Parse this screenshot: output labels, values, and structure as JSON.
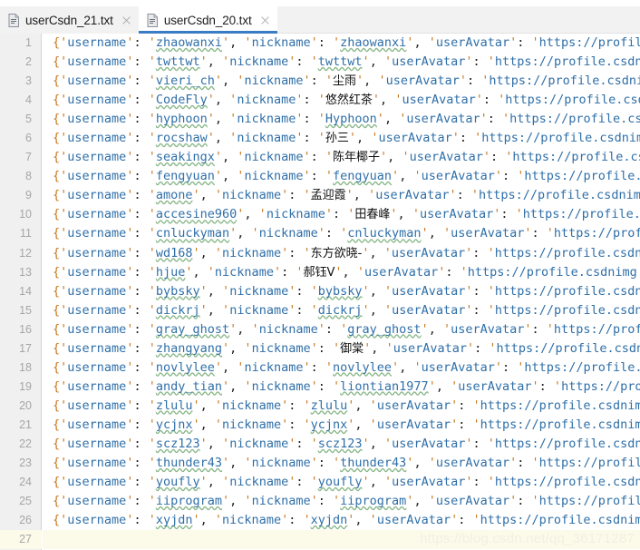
{
  "window": {
    "minimize_glyph": "minimize-icon"
  },
  "tabs": [
    {
      "label": "userCsdn_21.txt",
      "active": false,
      "icon": "file-text-icon",
      "close_icon": "close-icon"
    },
    {
      "label": "userCsdn_20.txt",
      "active": true,
      "icon": "file-text-icon",
      "close_icon": "close-icon"
    }
  ],
  "editor": {
    "accent_color": "#3a7cc4",
    "gutter_bg": "#f0f0f0",
    "current_line_bg": "#fcfbe9",
    "string_color": "#2f6fa8",
    "brace_color": "#c87820",
    "total_lines": 27,
    "current_line": 27,
    "lines": [
      {
        "no": 1,
        "username": "zhaowanxi",
        "nickname": "zhaowanxi",
        "avatar_prefix": "https://profile"
      },
      {
        "no": 2,
        "username": "twttwt",
        "nickname": "twttwt",
        "avatar_prefix": "https://profile.csdni"
      },
      {
        "no": 3,
        "username": "vieri_ch",
        "nickname": "尘雨",
        "avatar_prefix": "https://profile.csdnim"
      },
      {
        "no": 4,
        "username": "CodeFly",
        "nickname": "悠然红茶",
        "avatar_prefix": "https://profile.csdn"
      },
      {
        "no": 5,
        "username": "hyphoon",
        "nickname": "Hyphoon",
        "avatar_prefix": "https://profile.csd"
      },
      {
        "no": 6,
        "username": "rocshaw",
        "nickname": "孙三",
        "avatar_prefix": "https://profile.csdnimg"
      },
      {
        "no": 7,
        "username": "seakingx",
        "nickname": "陈年椰子",
        "avatar_prefix": "https://profile.csd"
      },
      {
        "no": 8,
        "username": "fengyuan",
        "nickname": "fengyuan",
        "avatar_prefix": "https://profile.c"
      },
      {
        "no": 9,
        "username": "amone",
        "nickname": "孟迎霞",
        "avatar_prefix": "https://profile.csdnimg"
      },
      {
        "no": 10,
        "username": "accesine960",
        "nickname": "田春峰",
        "avatar_prefix": "https://profile.cs"
      },
      {
        "no": 11,
        "username": "cnluckyman",
        "nickname": "cnluckyman",
        "avatar_prefix": "https://profi"
      },
      {
        "no": 12,
        "username": "wd168",
        "nickname": "东方欲晓-",
        "avatar_prefix": "https://profile.csdni"
      },
      {
        "no": 13,
        "username": "hjue",
        "nickname": "郝钰V",
        "avatar_prefix": "https://profile.csdnimg.c"
      },
      {
        "no": 14,
        "username": "bybsky",
        "nickname": "bybsky",
        "avatar_prefix": "https://profile.csdni"
      },
      {
        "no": 15,
        "username": "dickrj",
        "nickname": "dickrj",
        "avatar_prefix": "https://profile.csdni"
      },
      {
        "no": 16,
        "username": "gray_ghost",
        "nickname": "gray_ghost",
        "avatar_prefix": "https://profi"
      },
      {
        "no": 17,
        "username": "zhangyang",
        "nickname": "御棠",
        "avatar_prefix": "https://profile.csdni"
      },
      {
        "no": 18,
        "username": "novlylee",
        "nickname": "novlylee",
        "avatar_prefix": "https://profile.c"
      },
      {
        "no": 19,
        "username": "andy_tian",
        "nickname": "liontian1977",
        "avatar_prefix": "https://prof"
      },
      {
        "no": 20,
        "username": "zlulu",
        "nickname": "zlulu",
        "avatar_prefix": "https://profile.csdnimg"
      },
      {
        "no": 21,
        "username": "ycjnx",
        "nickname": "ycjnx",
        "avatar_prefix": "https://profile.csdnimg"
      },
      {
        "no": 22,
        "username": "scz123",
        "nickname": "scz123",
        "avatar_prefix": "https://profile.csdni"
      },
      {
        "no": 23,
        "username": "thunder43",
        "nickname": "thunder43",
        "avatar_prefix": "https://profile"
      },
      {
        "no": 24,
        "username": "youfly",
        "nickname": "youfly",
        "avatar_prefix": "https://profile.csdni"
      },
      {
        "no": 25,
        "username": "iiprogram",
        "nickname": "iiprogram",
        "avatar_prefix": "https://profile"
      },
      {
        "no": 26,
        "username": "xyjdn",
        "nickname": "xyjdn",
        "avatar_prefix": "https://profile.csdnimg"
      },
      {
        "no": 27,
        "username": null,
        "nickname": null,
        "avatar_prefix": null
      }
    ],
    "key_username": "username",
    "key_nickname": "nickname",
    "key_avatar": "userAvatar"
  },
  "watermark": {
    "text": "https://blog.csdn.net/qq_36171287"
  }
}
